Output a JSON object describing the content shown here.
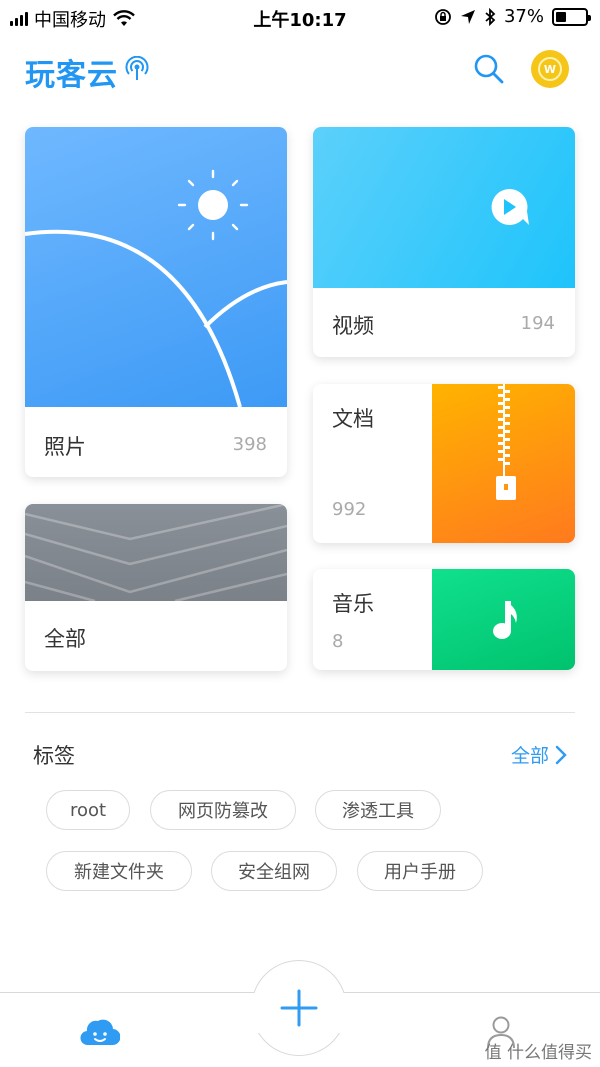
{
  "status_bar": {
    "carrier": "中国移动",
    "time": "上午10:17",
    "battery_text": "37%",
    "battery_level": 0.37
  },
  "header": {
    "title": "玩客云",
    "signal_icon": "signal-broadcast-icon",
    "search_icon": "search-icon",
    "coin_icon": "coin-icon",
    "coin_letter": "W"
  },
  "cards": {
    "photos": {
      "label": "照片",
      "count": "398"
    },
    "videos": {
      "label": "视频",
      "count": "194"
    },
    "docs": {
      "label": "文档",
      "count": "992"
    },
    "all": {
      "label": "全部"
    },
    "music": {
      "label": "音乐",
      "count": "8"
    }
  },
  "tags": {
    "title": "标签",
    "all_label": "全部",
    "items": [
      "root",
      "网页防篡改",
      "渗透工具",
      "新建文件夹",
      "安全组网",
      "用户手册"
    ]
  },
  "tabbar": {
    "home_icon": "cloud-face-icon",
    "add_icon": "plus-icon",
    "profile_icon": "person-icon",
    "watermark": "值 什么值得买"
  },
  "colors": {
    "accent": "#2196f3",
    "photos": "#4aa5f7",
    "videos": "#29c8fb",
    "docs": "#ff9710",
    "music": "#07d27e",
    "all": "#838990"
  }
}
